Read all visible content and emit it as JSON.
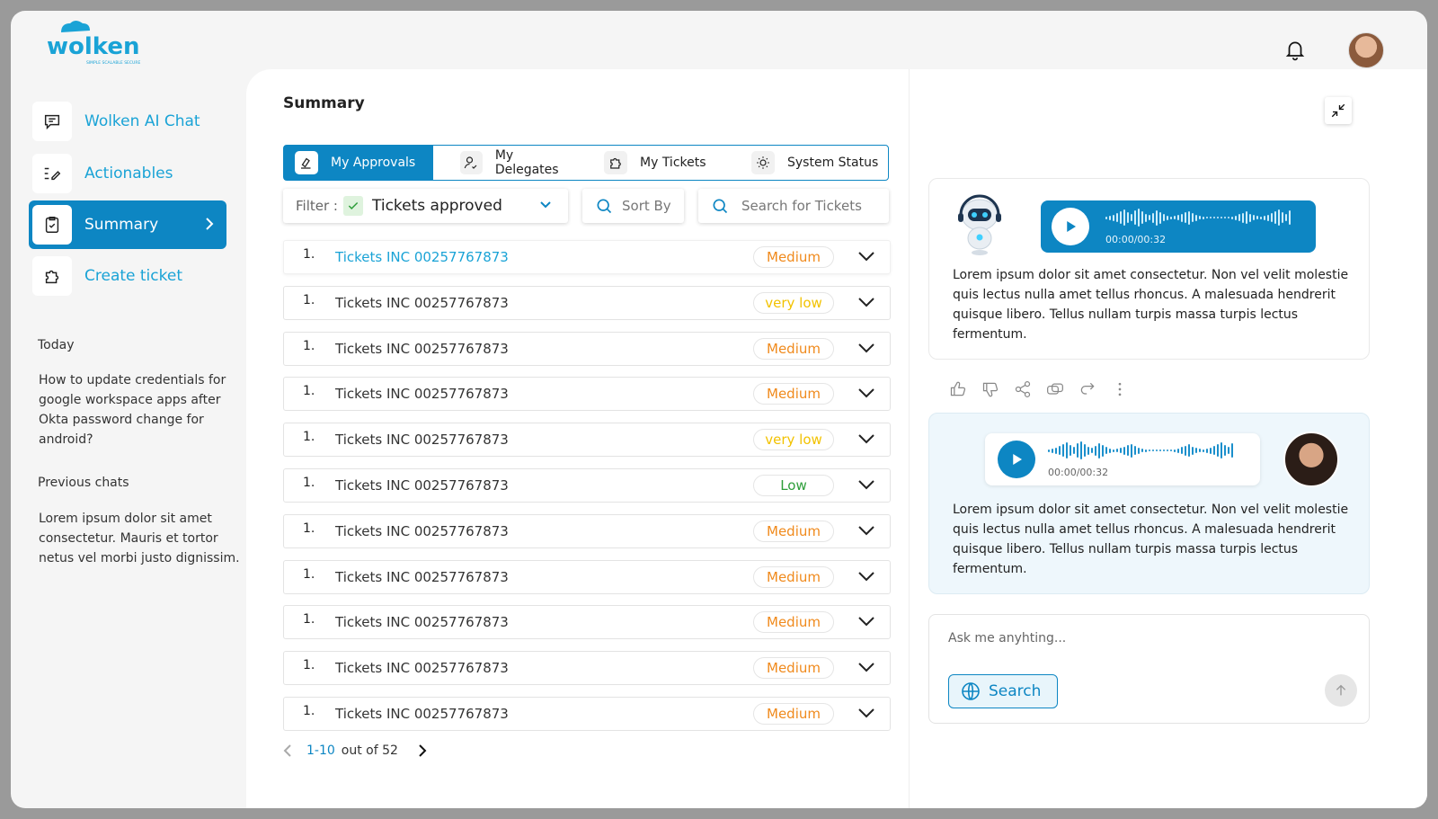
{
  "brand": {
    "name": "wolken",
    "tagline": "SIMPLE SCALABLE SECURE",
    "accent": "#0d86c3",
    "accent_light": "#1aa3d6"
  },
  "header": {
    "bell_icon": "bell-icon",
    "avatar": "user-avatar"
  },
  "sidebar": {
    "items": [
      {
        "label": "Wolken AI Chat",
        "icon": "chat-icon"
      },
      {
        "label": "Actionables",
        "icon": "list-edit-icon"
      },
      {
        "label": "Summary",
        "icon": "clipboard-check-icon",
        "active": true
      },
      {
        "label": "Create ticket",
        "icon": "puzzle-icon"
      }
    ],
    "today_heading": "Today",
    "today_text": "How to update credentials for google workspace apps after Okta password change for android?",
    "previous_heading": "Previous chats",
    "previous_text": "Lorem ipsum dolor sit amet consectetur. Mauris et tortor netus vel morbi justo dignissim."
  },
  "main": {
    "title": "Summary",
    "tabs": [
      {
        "label": "My Approvals",
        "icon": "approval-icon",
        "active": true
      },
      {
        "label": "My Delegates",
        "icon": "user-check-icon"
      },
      {
        "label": "My Tickets",
        "icon": "puzzle-icon"
      },
      {
        "label": "System Status",
        "icon": "sun-icon"
      }
    ],
    "filter": {
      "label": "Filter :",
      "value": "Tickets approved"
    },
    "sort_label": "Sort By",
    "search_placeholder": "Search for Tickets",
    "tickets": [
      {
        "num": "1.",
        "title": "Tickets INC 00257767873",
        "priority": "Medium"
      },
      {
        "num": "1.",
        "title": "Tickets INC 00257767873",
        "priority": "very low"
      },
      {
        "num": "1.",
        "title": "Tickets INC 00257767873",
        "priority": "Medium"
      },
      {
        "num": "1.",
        "title": "Tickets INC 00257767873",
        "priority": "Medium"
      },
      {
        "num": "1.",
        "title": "Tickets INC 00257767873",
        "priority": "very low"
      },
      {
        "num": "1.",
        "title": "Tickets INC 00257767873",
        "priority": "Low"
      },
      {
        "num": "1.",
        "title": "Tickets INC 00257767873",
        "priority": "Medium"
      },
      {
        "num": "1.",
        "title": "Tickets INC 00257767873",
        "priority": "Medium"
      },
      {
        "num": "1.",
        "title": "Tickets INC 00257767873",
        "priority": "Medium"
      },
      {
        "num": "1.",
        "title": "Tickets INC 00257767873",
        "priority": "Medium"
      },
      {
        "num": "1.",
        "title": "Tickets INC 00257767873",
        "priority": "Medium"
      }
    ],
    "priority_colors": {
      "Medium": "#f08a1c",
      "very low": "#f2c200",
      "Low": "#2e9e3a"
    },
    "pager": {
      "range": "1-10",
      "total": "out of 52"
    }
  },
  "chat": {
    "bot": {
      "time": "00:00/00:32",
      "text": "Lorem ipsum dolor sit amet consectetur. Non vel velit molestie quis lectus nulla amet tellus rhoncus. A malesuada hendrerit quisque libero. Tellus nullam turpis massa turpis lectus fermentum."
    },
    "user": {
      "time": "00:00/00:32",
      "text": "Lorem ipsum dolor sit amet consectetur. Non vel velit molestie quis lectus nulla amet tellus rhoncus. A malesuada hendrerit quisque libero. Tellus nullam turpis massa turpis lectus fermentum."
    },
    "actions": [
      "thumbs-up-icon",
      "thumbs-down-icon",
      "share-icon",
      "copy-icon",
      "redo-icon",
      "more-icon"
    ],
    "input_placeholder": "Ask me anyhting...",
    "search_button": "Search"
  }
}
